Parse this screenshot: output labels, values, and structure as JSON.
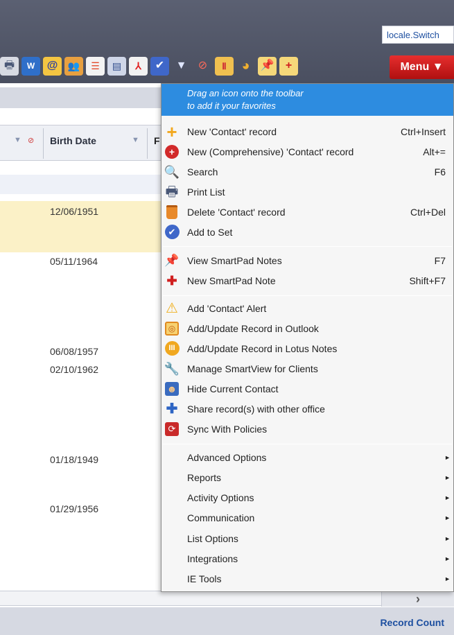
{
  "header": {
    "locale_label": "locale.Switch",
    "menu_button_label": "Menu ▼",
    "toolbar_icons": [
      "print-icon",
      "word-doc-icon",
      "email-icon",
      "contacts-icon",
      "checklist-icon",
      "list-icon",
      "pdf-icon",
      "add-to-set-icon",
      "filter-icon",
      "clear-filter-icon",
      "report-icon",
      "pie-chart-icon",
      "smartpad-note-icon",
      "new-smartpad-note-icon"
    ]
  },
  "grid": {
    "columns": [
      {
        "label": "Birth Date"
      },
      {
        "label": "F"
      }
    ],
    "rows": [
      {
        "birth_date": "12/06/1951"
      },
      {
        "birth_date": "05/11/1964"
      },
      {
        "birth_date": "06/08/1957"
      },
      {
        "birth_date": "02/10/1962"
      },
      {
        "birth_date": "01/18/1949"
      },
      {
        "birth_date": "01/29/1956"
      }
    ],
    "highlight_color": "#fbf1c7",
    "scroll_right_glyph": "›"
  },
  "footer": {
    "record_count_label": "Record Count"
  },
  "menu": {
    "tip_line1": "Drag an icon onto the toolbar",
    "tip_line2": "to add it your favorites",
    "items": [
      {
        "label": "New 'Contact' record",
        "shortcut": "Ctrl+Insert",
        "icon": "plus-icon"
      },
      {
        "label": "New (Comprehensive) 'Contact' record",
        "shortcut": "Alt+=",
        "icon": "comprehensive-add-icon"
      },
      {
        "label": "Search",
        "shortcut": "F6",
        "icon": "search-icon"
      },
      {
        "label": "Print List",
        "shortcut": "",
        "icon": "print-icon"
      },
      {
        "label": "Delete 'Contact' record",
        "shortcut": "Ctrl+Del",
        "icon": "trash-icon"
      },
      {
        "label": "Add to Set",
        "shortcut": "",
        "icon": "add-to-set-icon"
      },
      {
        "label": "View SmartPad Notes",
        "shortcut": "F7",
        "icon": "smartpad-note-icon"
      },
      {
        "label": "New SmartPad Note",
        "shortcut": "Shift+F7",
        "icon": "new-smartpad-note-icon"
      },
      {
        "label": "Add 'Contact' Alert",
        "shortcut": "",
        "icon": "alert-icon"
      },
      {
        "label": "Add/Update Record in Outlook",
        "shortcut": "",
        "icon": "outlook-icon"
      },
      {
        "label": "Add/Update Record in Lotus Notes",
        "shortcut": "",
        "icon": "lotus-notes-icon"
      },
      {
        "label": "Manage SmartView for Clients",
        "shortcut": "",
        "icon": "smartview-icon"
      },
      {
        "label": "Hide Current Contact",
        "shortcut": "",
        "icon": "hide-contact-icon"
      },
      {
        "label": "Share record(s) with other office",
        "shortcut": "",
        "icon": "share-icon"
      },
      {
        "label": "Sync With Policies",
        "shortcut": "",
        "icon": "sync-icon"
      }
    ],
    "submenus": [
      {
        "label": "Advanced Options"
      },
      {
        "label": "Reports"
      },
      {
        "label": "Activity Options"
      },
      {
        "label": "Communication"
      },
      {
        "label": "List Options"
      },
      {
        "label": "Integrations"
      },
      {
        "label": "IE Tools"
      }
    ],
    "submenu_arrow": "►",
    "accent_color": "#2d8ce0"
  }
}
